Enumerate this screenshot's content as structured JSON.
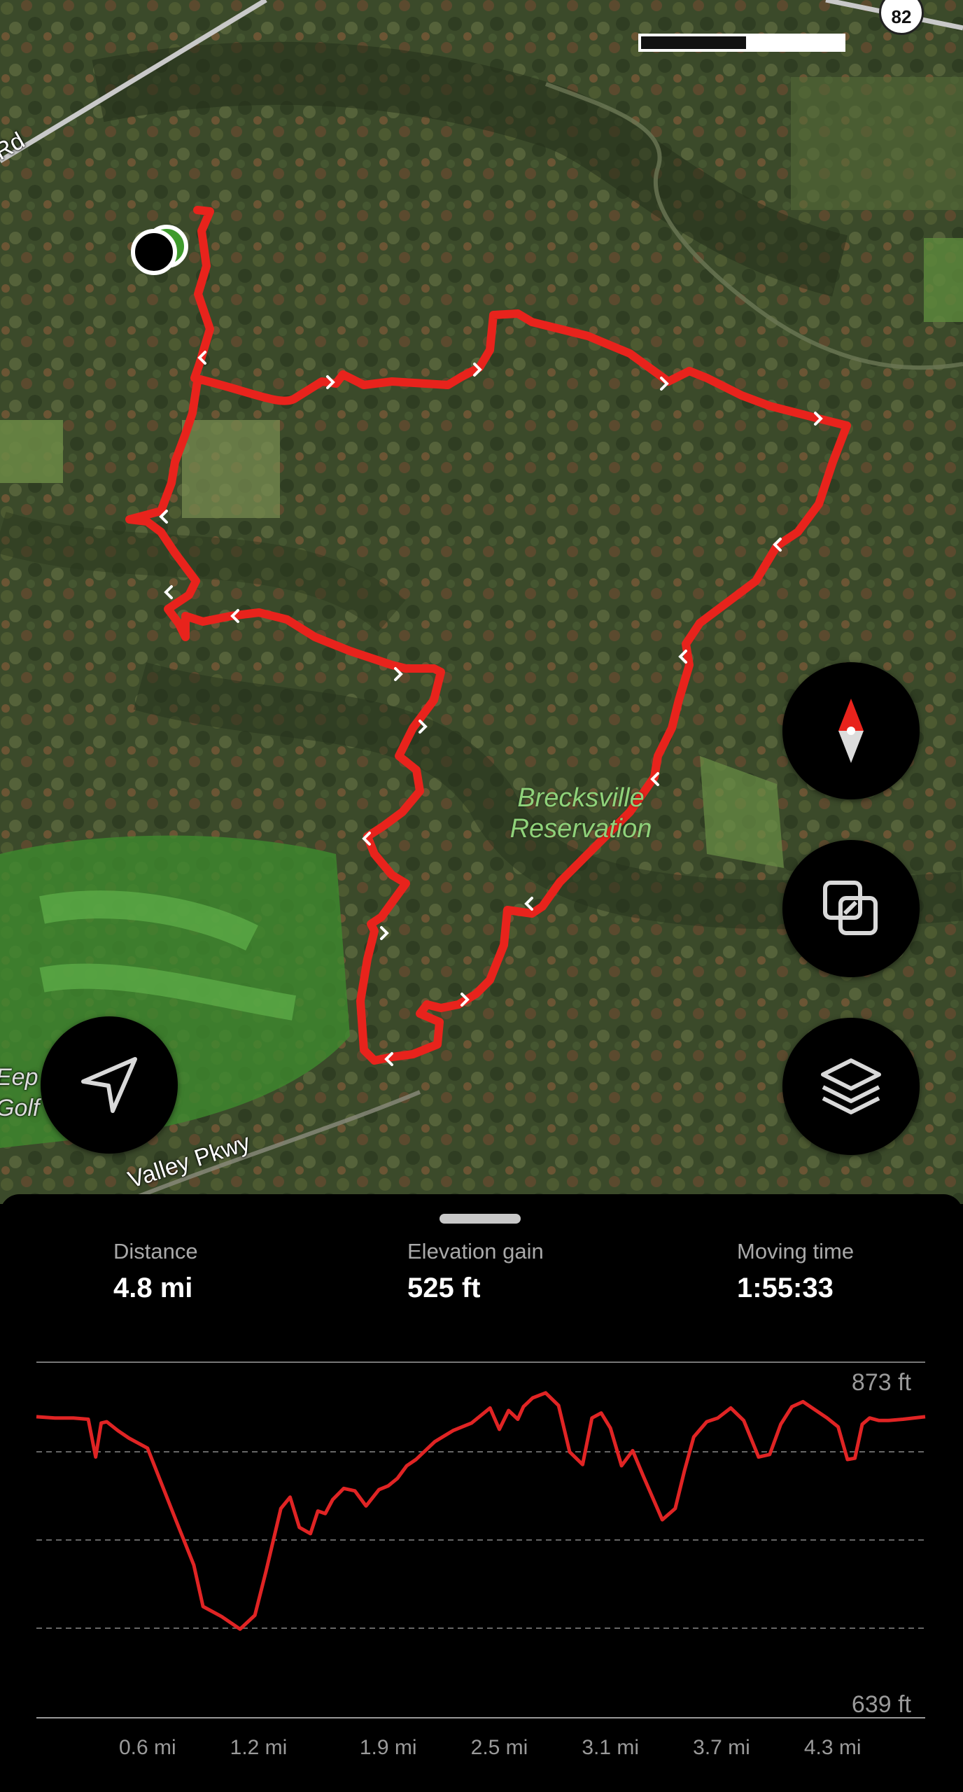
{
  "map": {
    "road_labels": [
      "Valley Pkwy",
      "Rd",
      "Eep",
      "Golf"
    ],
    "route_shield": "82",
    "park_label_line1": "Brecksville",
    "park_label_line2": "Reservation",
    "buttons": {
      "compass": "compass-icon",
      "layers_toggle": "map-overlay-icon",
      "layers": "layers-icon",
      "locate": "navigation-arrow-icon"
    },
    "route_color": "#e8231c"
  },
  "stats": {
    "distance_label": "Distance",
    "distance_value": "4.8 mi",
    "elevation_label": "Elevation gain",
    "elevation_value": "525 ft",
    "time_label": "Moving time",
    "time_value": "1:55:33"
  },
  "chart_data": {
    "type": "line",
    "title": "",
    "xlabel": "",
    "ylabel": "",
    "y_max_label": "873 ft",
    "y_min_label": "639 ft",
    "ylim": [
      639,
      873
    ],
    "xlim": [
      0,
      4.8
    ],
    "x_tick_labels": [
      "0.6 mi",
      "1.2 mi",
      "1.9 mi",
      "2.5 mi",
      "3.1 mi",
      "3.7 mi",
      "4.3 mi"
    ],
    "x_ticks": [
      0.6,
      1.2,
      1.9,
      2.5,
      3.1,
      3.7,
      4.3
    ],
    "line_color": "#e02424",
    "grid": "dashed horizontal",
    "series": [
      {
        "x": [
          0,
          0.1,
          0.2,
          0.28,
          0.32,
          0.35,
          0.38,
          0.44,
          0.5,
          0.6,
          0.75,
          0.85,
          0.9,
          1.0,
          1.1,
          1.18,
          1.24,
          1.32,
          1.37,
          1.42,
          1.48,
          1.52,
          1.56,
          1.6,
          1.66,
          1.72,
          1.78,
          1.85,
          1.9,
          1.95,
          2.0,
          2.05,
          2.15,
          2.25,
          2.35,
          2.45,
          2.5,
          2.55,
          2.6,
          2.63,
          2.68,
          2.75,
          2.82,
          2.88,
          2.95,
          3.0,
          3.05,
          3.1,
          3.16,
          3.22,
          3.28,
          3.38,
          3.45,
          3.5,
          3.55,
          3.62,
          3.68,
          3.75,
          3.82,
          3.9,
          3.96,
          4.02,
          4.08,
          4.14,
          4.2,
          4.27,
          4.33,
          4.38,
          4.42,
          4.46,
          4.5,
          4.55,
          4.6,
          4.68,
          4.8
        ],
        "y": [
          863,
          862,
          862,
          861,
          831,
          858,
          859,
          852,
          846,
          838,
          782,
          745,
          712,
          704,
          694,
          705,
          740,
          790,
          799,
          775,
          770,
          788,
          786,
          797,
          806,
          804,
          792,
          805,
          808,
          814,
          824,
          829,
          843,
          852,
          858,
          870,
          853,
          868,
          861,
          871,
          878,
          882,
          872,
          835,
          825,
          862,
          866,
          854,
          824,
          836,
          815,
          781,
          790,
          820,
          847,
          859,
          862,
          870,
          860,
          831,
          833,
          857,
          871,
          875,
          869,
          862,
          855,
          829,
          830,
          857,
          862,
          860,
          860,
          861,
          863
        ]
      }
    ]
  }
}
